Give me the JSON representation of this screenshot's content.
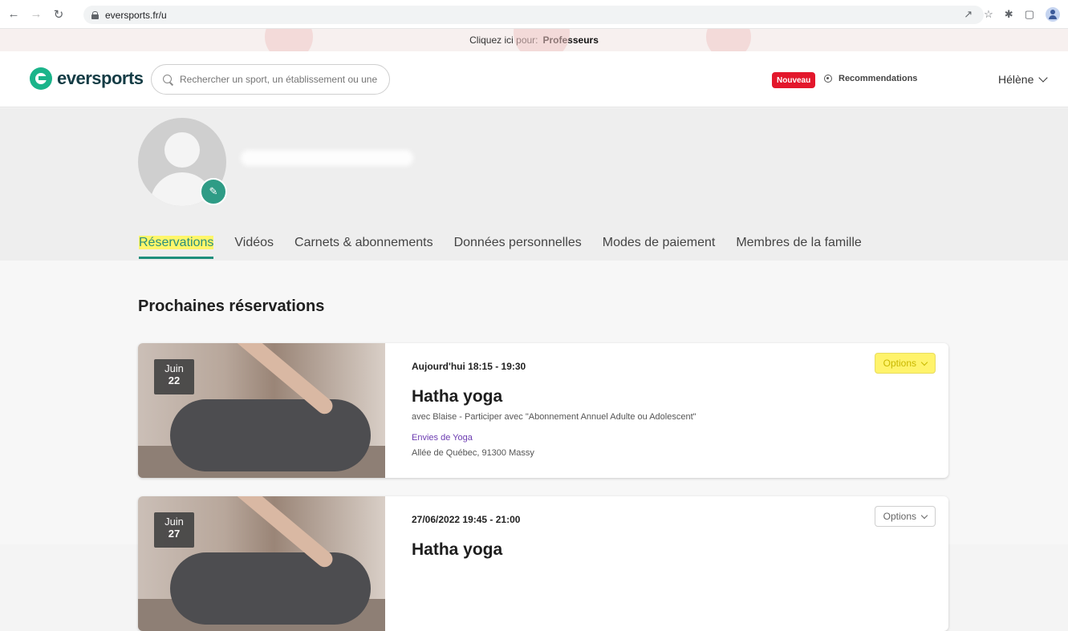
{
  "browser": {
    "url": "eversports.fr/u"
  },
  "promo": {
    "prefix": "Cliquez ici pour:",
    "link": "Professeurs"
  },
  "header": {
    "logo": "eversports",
    "search_placeholder": "Rechercher un sport, un établissement ou une",
    "badge": "Nouveau",
    "recommendations": "Recommendations",
    "user": "Hélène"
  },
  "tabs": [
    "Réservations",
    "Vidéos",
    "Carnets & abonnements",
    "Données personnelles",
    "Modes de paiement",
    "Membres de la famille"
  ],
  "section": {
    "title": "Prochaines réservations"
  },
  "bookings": [
    {
      "month": "Juin",
      "day": "22",
      "when": "Aujourd'hui 18:15 - 19:30",
      "title": "Hatha yoga",
      "subtitle": "avec Blaise - Participer avec \"Abonnement Annuel Adulte ou Adolescent\"",
      "venue": "Envies de Yoga",
      "address": "Allée de Québec, 91300 Massy",
      "options": "Options"
    },
    {
      "month": "Juin",
      "day": "27",
      "when": "27/06/2022 19:45 - 21:00",
      "title": "Hatha yoga",
      "options": "Options"
    }
  ],
  "colors": {
    "brand": "#1bb48a",
    "accent": "#1e8f7c",
    "badge": "#e3172c",
    "highlight": "#fff36b",
    "venue": "#6b3bb0"
  }
}
